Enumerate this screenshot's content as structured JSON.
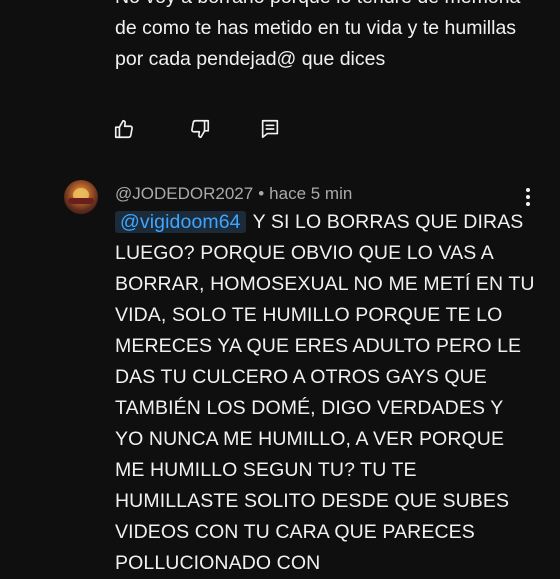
{
  "previous_comment": {
    "text": "No voy a borrarlo porque lo tendré de memoria de como te has metido en tu vida y te humillas por cada pendejad@ que dices"
  },
  "actions": {
    "like_icon": "thumb-up-icon",
    "dislike_icon": "thumb-down-icon",
    "reply_icon": "comment-reply-icon"
  },
  "reply": {
    "author": "@JODEDOR2027",
    "separator": "•",
    "time": "hace 5 min",
    "mention": "@vigidoom64",
    "text": "Y SI LO BORRAS QUE DIRAS LUEGO? PORQUE OBVIO QUE LO VAS A BORRAR, HOMOSEXUAL NO ME METÍ EN TU VIDA, SOLO TE HUMILLO PORQUE TE LO MERECES YA QUE ERES ADULTO PERO LE DAS TU CULCERO A OTROS GAYS QUE TAMBIÉN LOS DOMÉ, DIGO VERDADES Y YO NUNCA ME HUMILLO, A VER PORQUE ME HUMILLO SEGUN TU? TU TE HUMILLASTE SOLITO DESDE QUE SUBES VIDEOS CON TU CARA QUE PARECES POLLUCIONADO CON"
  },
  "colors": {
    "background": "#0f0f0f",
    "text": "#f1f1f1",
    "muted": "#aaaaaa",
    "mention": "#3ea6ff"
  }
}
